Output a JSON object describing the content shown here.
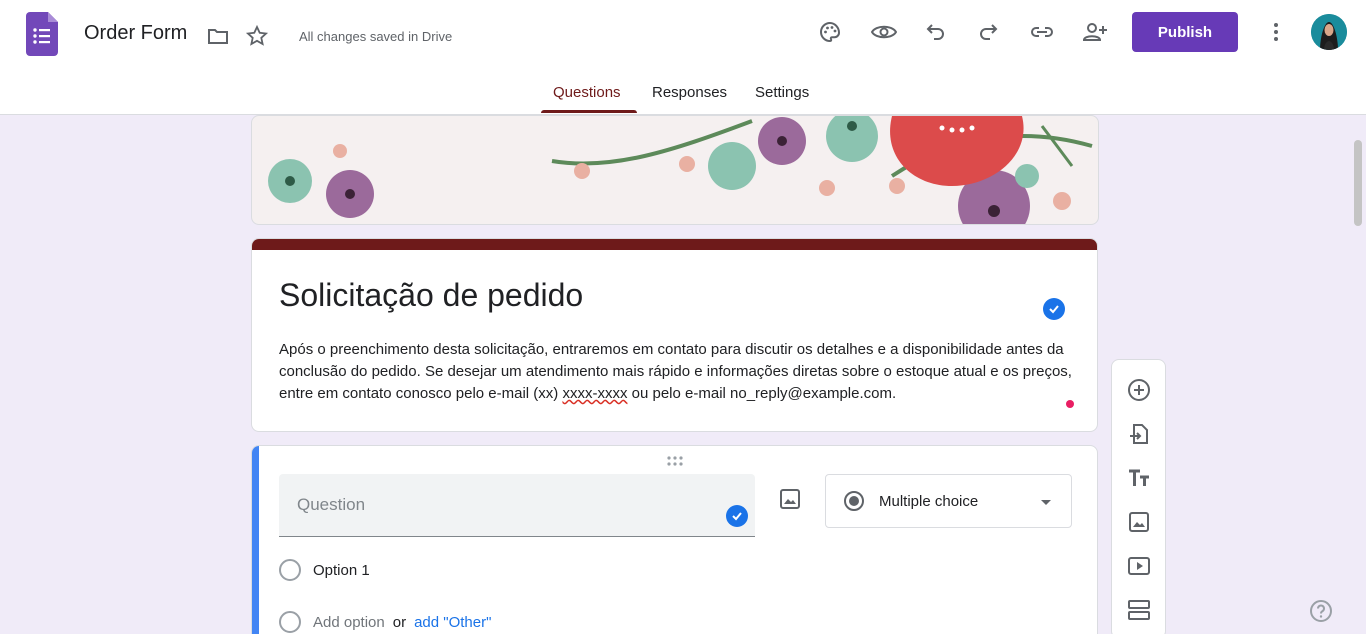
{
  "header": {
    "doc_title": "Order Form",
    "saved_status": "All changes saved in Drive",
    "publish_label": "Publish",
    "icons": [
      "forms-logo-icon",
      "folder-icon",
      "star-icon",
      "palette-icon",
      "preview-eye-icon",
      "undo-icon",
      "redo-icon",
      "link-icon",
      "add-collaborator-icon",
      "more-vert-icon"
    ]
  },
  "tabs": [
    {
      "label": "Questions",
      "active": true
    },
    {
      "label": "Responses",
      "active": false
    },
    {
      "label": "Settings",
      "active": false
    }
  ],
  "form": {
    "title": "Solicitação de pedido",
    "description": "Após o preenchimento desta solicitação, entraremos em contato para discutir os detalhes e a disponibilidade antes da conclusão do pedido. Se desejar um atendimento mais rápido e informações diretas sobre o estoque atual e os preços, entre em contato conosco pelo e-mail (xx) xxxx-xxxx ou pelo e-mail no_reply@example.com.",
    "desc_part1": "Após o preenchimento desta solicitação, entraremos em contato para discutir os detalhes e a disponibilidade antes da conclusão do pedido. Se desejar um atendimento mais rápido e informações diretas sobre o estoque atual e os preços, entre em contato conosco pelo e-mail (xx) ",
    "desc_misspelled": "xxxx-xxxx",
    "desc_part2": " ou pelo e-mail no_reply@example.com."
  },
  "question": {
    "placeholder": "Question",
    "type": "Multiple choice",
    "options": [
      "Option 1"
    ],
    "add_option": "Add option",
    "or": "or",
    "add_other": "add \"Other\""
  },
  "side_toolbar": {
    "icons": [
      "add-question-icon",
      "import-questions-icon",
      "add-title-icon",
      "add-image-icon",
      "add-video-icon",
      "add-section-icon"
    ]
  },
  "colors": {
    "accent": "#673ab7",
    "theme": "#6e1a1a",
    "focus": "#4285f4",
    "background": "#f0ebf8"
  }
}
